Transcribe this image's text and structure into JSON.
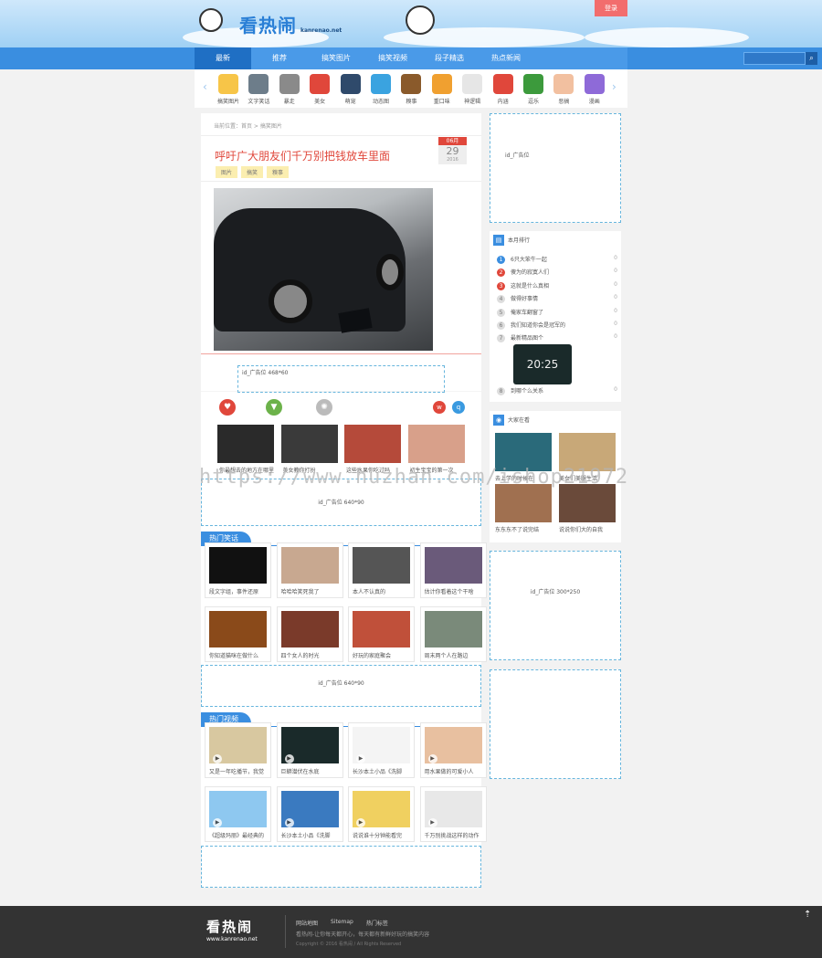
{
  "header": {
    "logo": "看热闹",
    "logo_sub": "kanrenao.net",
    "login": "登录"
  },
  "nav": {
    "items": [
      "最新",
      "推荐",
      "搞笑图片",
      "搞笑视频",
      "段子精选",
      "热点新闻"
    ],
    "search_placeholder": ""
  },
  "categories": [
    {
      "label": "搞笑图片",
      "color": "#f7c548"
    },
    {
      "label": "文字笑话",
      "color": "#6d7d8a"
    },
    {
      "label": "暴走",
      "color": "#8a8a8a"
    },
    {
      "label": "美女",
      "color": "#e0473b"
    },
    {
      "label": "萌宠",
      "color": "#2f4a6b"
    },
    {
      "label": "动态图",
      "color": "#3aa3e0"
    },
    {
      "label": "糗事",
      "color": "#8a5a2b"
    },
    {
      "label": "重口味",
      "color": "#f0a030"
    },
    {
      "label": "神逻辑",
      "color": "#e6e6e6"
    },
    {
      "label": "内涵",
      "color": "#e0473b"
    },
    {
      "label": "逗乐",
      "color": "#3c9a3c"
    },
    {
      "label": "恶搞",
      "color": "#f2c0a0"
    },
    {
      "label": "漫画",
      "color": "#8e6ad8"
    }
  ],
  "breadcrumb": "当前位置：首页 > 搞笑图片",
  "article": {
    "title": "呼吁广大朋友们千万别把钱放车里面",
    "date": {
      "month": "06月",
      "day": "29",
      "year": "2016"
    },
    "tags": [
      "图片",
      "搞笑",
      "糗事"
    ]
  },
  "ads": {
    "inline": "id_广告位 468*60",
    "banner1": "id_广告位 640*90",
    "banner2": "id_广告位 640*90",
    "side1": "id_广告位",
    "side2": "id_广告位 300*250"
  },
  "related": [
    {
      "title": "你最想去的地方在哪里",
      "color": "#2a2a2a"
    },
    {
      "title": "美女教你打扮",
      "color": "#3a3a3a"
    },
    {
      "title": "这些水果你吃过吗",
      "color": "#b54a3a"
    },
    {
      "title": "初生宝宝的第一次",
      "color": "#d8a08a"
    }
  ],
  "hot_jokes": {
    "heading": "热门笑话",
    "items": [
      {
        "title": "段文字组，事件还原",
        "color": "#111"
      },
      {
        "title": "哈哈哈笑死我了",
        "color": "#c8a890"
      },
      {
        "title": "本人不认真的",
        "color": "#555"
      },
      {
        "title": "估计你看着这个干啥",
        "color": "#6a5a7a"
      },
      {
        "title": "你知道猫咪在做什么",
        "color": "#8a4a1a"
      },
      {
        "title": "四个女人的时光",
        "color": "#7a3a2a"
      },
      {
        "title": "好玩的家庭聚会",
        "color": "#c0503a"
      },
      {
        "title": "周末两个人在路边",
        "color": "#7a8a7a"
      }
    ]
  },
  "hot_videos": {
    "heading": "热门视频",
    "items": [
      {
        "title": "又是一年吃播节，我觉",
        "color": "#d8c8a0"
      },
      {
        "title": "巨蟒潜伏在水底",
        "color": "#1a2a2a"
      },
      {
        "title": "长沙本土小品《洗脚",
        "color": "#f4f4f4"
      },
      {
        "title": "用水果做的可爱小人",
        "color": "#e8c0a0"
      },
      {
        "title": "《超级玛丽》最经典的",
        "color": "#8ec8f0"
      },
      {
        "title": "长沙本土小品《洗脚",
        "color": "#3a7ac0"
      },
      {
        "title": "说说谁十分钟能看完",
        "color": "#f0d060"
      },
      {
        "title": "千万别挑战这样的动作",
        "color": "#e8e8e8"
      }
    ]
  },
  "monthly_rank": {
    "heading": "本月排行",
    "items": [
      {
        "rank": "1",
        "title": "6只大笨牛一起",
        "count": "0"
      },
      {
        "rank": "2",
        "title": "傻为的寂寞人们",
        "count": "0"
      },
      {
        "rank": "3",
        "title": "这就是什么真相",
        "count": "0"
      },
      {
        "rank": "4",
        "title": "做得好事情",
        "count": "0"
      },
      {
        "rank": "5",
        "title": "俺家车翻窗了",
        "count": "0"
      },
      {
        "rank": "6",
        "title": "我们知道你会是冠军的",
        "count": "0"
      },
      {
        "rank": "7",
        "title": "最新精品图个",
        "count": "0"
      },
      {
        "rank": "8",
        "title": "到哪个么关系",
        "count": "0"
      }
    ],
    "phone_time": "20:25"
  },
  "watching": {
    "heading": "大家在看",
    "items": [
      {
        "title": "去上学的时候在",
        "color": "#2a6a7a"
      },
      {
        "title": "美女们美腿生活",
        "color": "#c8a878"
      },
      {
        "title": "东东东不了说完结",
        "color": "#a07050"
      },
      {
        "title": "说说你们大的自我",
        "color": "#6a4a3a"
      }
    ]
  },
  "footer": {
    "logo": "看热闹",
    "logo_sub": "www.kanrenao.net",
    "links": [
      "网站地图",
      "Sitemap",
      "热门标签"
    ],
    "line": "看热闹-让你每天都开心，每天都有新鲜好玩的搞笑内容",
    "copyright": "Copyright © 2016 看热闹 / All Rights Reserved"
  },
  "watermark": "https://www.huzhan.com/ishop21972"
}
